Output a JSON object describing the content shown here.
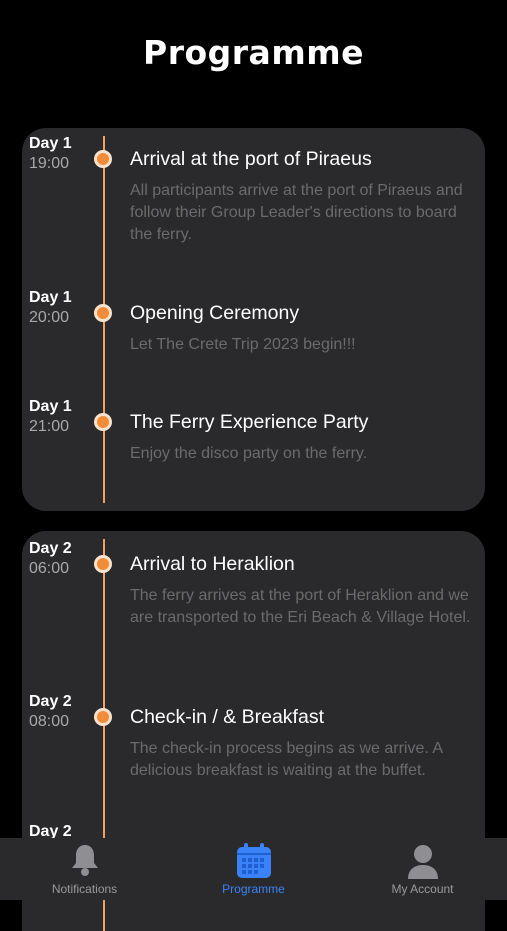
{
  "header": {
    "title": "Programme"
  },
  "cards": [
    {
      "events": [
        {
          "day": "Day 1",
          "time": "19:00",
          "title": "Arrival at the port of Piraeus",
          "description": "All participants arrive at the port of Piraeus and follow their Group Leader's directions to board the ferry."
        },
        {
          "day": "Day 1",
          "time": "20:00",
          "title": "Opening Ceremony",
          "description": "Let The Crete Trip 2023 begin!!!"
        },
        {
          "day": "Day 1",
          "time": "21:00",
          "title": "The Ferry Experience Party",
          "description": "Enjoy the disco party on the ferry."
        }
      ]
    },
    {
      "events": [
        {
          "day": "Day 2",
          "time": "06:00",
          "title": "Arrival to Heraklion",
          "description": "The ferry arrives at the port of Heraklion and we are transported to the Eri Beach & Village Hotel."
        },
        {
          "day": "Day 2",
          "time": "08:00",
          "title": "Check-in / & Breakfast",
          "description": "The check-in process begins as we arrive. A delicious breakfast is waiting at the buffet."
        },
        {
          "day": "Day 2"
        }
      ]
    }
  ],
  "tabbar": {
    "items": [
      {
        "label": "Notifications",
        "icon": "bell-icon"
      },
      {
        "label": "Programme",
        "icon": "calendar-icon",
        "active": true
      },
      {
        "label": "My Account",
        "icon": "person-icon"
      }
    ],
    "active_color": "#3a82f7",
    "accent": "#f28c38"
  }
}
